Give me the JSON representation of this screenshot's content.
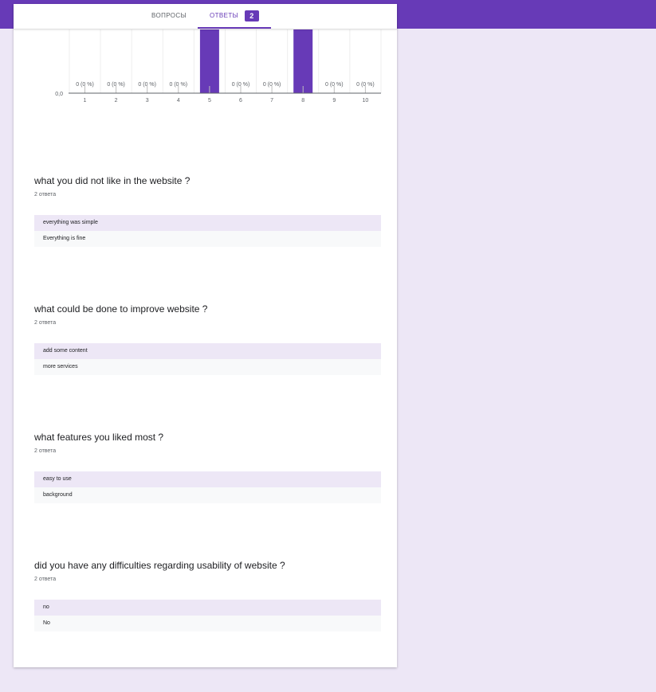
{
  "tabs": {
    "questions_label": "ВОПРОСЫ",
    "answers_label": "ОТВЕТЫ",
    "answers_count": "2"
  },
  "chart_data": {
    "type": "bar",
    "categories": [
      "1",
      "2",
      "3",
      "4",
      "5",
      "6",
      "7",
      "8",
      "9",
      "10"
    ],
    "values": [
      0,
      0,
      0,
      0,
      1,
      0,
      0,
      1,
      0,
      0
    ],
    "data_labels": [
      "0 (0 %)",
      "0 (0 %)",
      "0 (0 %)",
      "0 (0 %)",
      "",
      "0 (0 %)",
      "0 (0 %)",
      "",
      "0 (0 %)",
      "0 (0 %)"
    ],
    "y_tick_labels": [
      "0,0"
    ],
    "color": "#673ab7"
  },
  "questions": [
    {
      "title": "what you did not like in the website ?",
      "count": "2 ответа",
      "answers": [
        "everything was simple",
        "Everything is fine"
      ]
    },
    {
      "title": "what could be done to improve website ?",
      "count": "2 ответа",
      "answers": [
        "add some content",
        "more services"
      ]
    },
    {
      "title": "what features you liked most ?",
      "count": "2 ответа",
      "answers": [
        "easy to use",
        "background"
      ]
    },
    {
      "title": "did you have any difficulties regarding usability of website ?",
      "count": "2 ответа",
      "answers": [
        "no",
        "No"
      ]
    }
  ],
  "colors": {
    "accent": "#673ab7",
    "page_background": "#ede7f6",
    "answer_row_odd": "#ede7f6",
    "answer_row_even": "#f8f9fa"
  }
}
